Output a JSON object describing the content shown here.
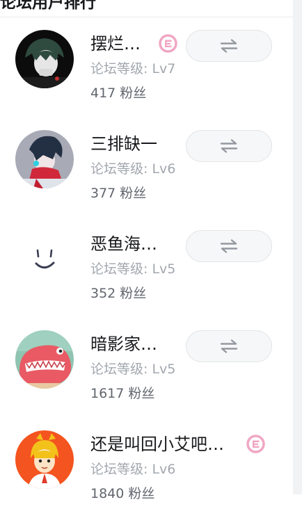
{
  "header": {
    "title": "论坛用户排行"
  },
  "colors": {
    "badge_pink": "#f0a7c4",
    "button_bg": "#f6f7f8",
    "icon_gray": "#9499a0"
  },
  "users": [
    {
      "name": "摆烂…",
      "level": "论坛等级: Lv7",
      "fans": "417 粉丝",
      "badge": "level-badge-icon",
      "follow_icon": "exchange-arrows-icon"
    },
    {
      "name": "三排缺一",
      "level": "论坛等级: Lv6",
      "fans": "377 粉丝",
      "follow_icon": "exchange-arrows-icon"
    },
    {
      "name": "恶鱼海…",
      "level": "论坛等级: Lv5",
      "fans": "352 粉丝",
      "follow_icon": "exchange-arrows-icon"
    },
    {
      "name": "暗影家…",
      "level": "论坛等级: Lv5",
      "fans": "1617 粉丝",
      "follow_icon": "exchange-arrows-icon"
    },
    {
      "name": "还是叫回小艾吧…",
      "level": "论坛等级: Lv6",
      "fans": "1840 粉丝",
      "badge": "level-badge-icon"
    }
  ]
}
